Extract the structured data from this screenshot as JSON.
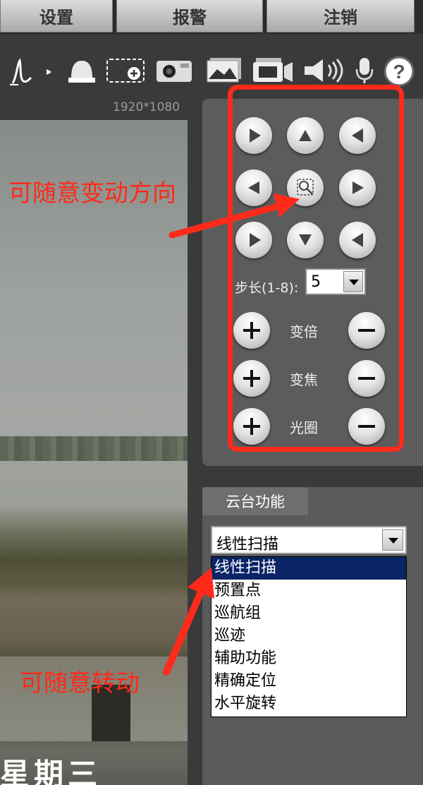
{
  "topnav": {
    "settings": "设置",
    "alarm": "报警",
    "logout": "注销"
  },
  "toolbar": {
    "icons": [
      "pen-icon",
      "alarm-bell-icon",
      "zoom-region-icon",
      "snapshot-icon",
      "image-icon",
      "record-icon",
      "speaker-icon",
      "microphone-icon",
      "help-icon"
    ]
  },
  "video": {
    "resolution": "1920*1080",
    "overlay_text": "星期三"
  },
  "ptz": {
    "step_label": "步长(1-8):",
    "step_value": "5",
    "zoom_label": "变倍",
    "focus_label": "变焦",
    "iris_label": "光圈"
  },
  "ptz_function": {
    "tab_label": "云台功能",
    "selected": "线性扫描",
    "options": [
      "线性扫描",
      "预置点",
      "巡航组",
      "巡迹",
      "辅助功能",
      "精确定位",
      "水平旋转"
    ]
  },
  "annotations": {
    "direction": "可随意变动方向",
    "rotate": "可随意转动"
  },
  "colors": {
    "accent_red": "#ff2a1a",
    "selection_blue": "#0a2466",
    "panel_gray": "#5c5c5c"
  }
}
